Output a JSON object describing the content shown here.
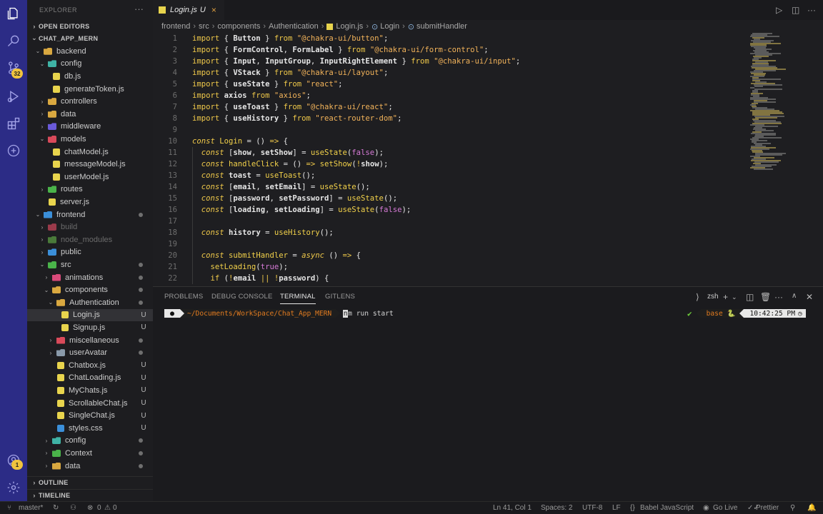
{
  "activity_bar": {
    "items": [
      "explorer-icon",
      "search-icon",
      "source-control-icon",
      "run-debug-icon",
      "extensions-icon",
      "remote-icon"
    ],
    "scm_badge": "32",
    "account_badge": "1",
    "bottom": [
      "account-icon",
      "gear-icon"
    ]
  },
  "sidebar": {
    "title": "EXPLORER",
    "more": "···",
    "open_editors": "OPEN EDITORS",
    "project": "CHAT_APP_MERN",
    "outline": "OUTLINE",
    "timeline": "TIMELINE",
    "tree": [
      {
        "label": "backend",
        "kind": "folder",
        "open": true,
        "indent": 1,
        "color": "#d9a840"
      },
      {
        "label": "config",
        "kind": "folder",
        "open": true,
        "indent": 2,
        "color": "#3fb3a5"
      },
      {
        "label": "db.js",
        "kind": "js",
        "indent": 3
      },
      {
        "label": "generateToken.js",
        "kind": "js",
        "indent": 3
      },
      {
        "label": "controllers",
        "kind": "folder",
        "open": false,
        "indent": 2,
        "color": "#d9a840"
      },
      {
        "label": "data",
        "kind": "folder",
        "open": false,
        "indent": 2,
        "color": "#d9a840"
      },
      {
        "label": "middleware",
        "kind": "folder",
        "open": false,
        "indent": 2,
        "color": "#6a5ad9"
      },
      {
        "label": "models",
        "kind": "folder",
        "open": true,
        "indent": 2,
        "color": "#d94a5a"
      },
      {
        "label": "chatModel.js",
        "kind": "js",
        "indent": 3
      },
      {
        "label": "messageModel.js",
        "kind": "js",
        "indent": 3
      },
      {
        "label": "userModel.js",
        "kind": "js",
        "indent": 3
      },
      {
        "label": "routes",
        "kind": "folder",
        "open": false,
        "indent": 2,
        "color": "#4ab34a"
      },
      {
        "label": "server.js",
        "kind": "js",
        "indent": 2
      },
      {
        "label": "frontend",
        "kind": "folder",
        "open": true,
        "indent": 1,
        "color": "#3b8fd9",
        "dot": true
      },
      {
        "label": "build",
        "kind": "folder",
        "open": false,
        "indent": 2,
        "color": "#9a3a4a",
        "dim": true
      },
      {
        "label": "node_modules",
        "kind": "folder",
        "open": false,
        "indent": 2,
        "color": "#4a7a3a",
        "dim": true
      },
      {
        "label": "public",
        "kind": "folder",
        "open": false,
        "indent": 2,
        "color": "#3b8fd9"
      },
      {
        "label": "src",
        "kind": "folder",
        "open": true,
        "indent": 2,
        "color": "#4ab34a",
        "dot": true
      },
      {
        "label": "animations",
        "kind": "folder",
        "open": false,
        "indent": 3,
        "color": "#d94a7a",
        "dot": true
      },
      {
        "label": "components",
        "kind": "folder",
        "open": true,
        "indent": 3,
        "color": "#d9a840",
        "dot": true
      },
      {
        "label": "Authentication",
        "kind": "folder",
        "open": true,
        "indent": 4,
        "color": "#d9a840",
        "dot": true
      },
      {
        "label": "Login.js",
        "kind": "js",
        "indent": 5,
        "status": "U",
        "selected": true
      },
      {
        "label": "Signup.js",
        "kind": "js",
        "indent": 5,
        "status": "U"
      },
      {
        "label": "miscellaneous",
        "kind": "folder",
        "open": false,
        "indent": 4,
        "color": "#d94a5a",
        "dot": true
      },
      {
        "label": "userAvatar",
        "kind": "folder",
        "open": false,
        "indent": 4,
        "color": "#8a9aaa",
        "dot": true
      },
      {
        "label": "Chatbox.js",
        "kind": "js",
        "indent": 4,
        "status": "U"
      },
      {
        "label": "ChatLoading.js",
        "kind": "js",
        "indent": 4,
        "status": "U"
      },
      {
        "label": "MyChats.js",
        "kind": "js",
        "indent": 4,
        "status": "U"
      },
      {
        "label": "ScrollableChat.js",
        "kind": "js",
        "indent": 4,
        "status": "U"
      },
      {
        "label": "SingleChat.js",
        "kind": "js",
        "indent": 4,
        "status": "U"
      },
      {
        "label": "styles.css",
        "kind": "css",
        "indent": 4,
        "status": "U"
      },
      {
        "label": "config",
        "kind": "folder",
        "open": false,
        "indent": 3,
        "color": "#3fb3a5",
        "dot": true
      },
      {
        "label": "Context",
        "kind": "folder",
        "open": false,
        "indent": 3,
        "color": "#4ab34a",
        "dot": true
      },
      {
        "label": "data",
        "kind": "folder",
        "open": false,
        "indent": 3,
        "color": "#d9a840",
        "dot": true
      }
    ]
  },
  "tab": {
    "name": "Login.js",
    "status": "U",
    "close": "×"
  },
  "editor_actions": [
    "run-icon",
    "split-editor-icon",
    "more-icon"
  ],
  "breadcrumb": [
    "frontend",
    "src",
    "components",
    "Authentication",
    "Login.js",
    "Login",
    "submitHandler"
  ],
  "code": {
    "lines": [
      {
        "n": "1",
        "html": "<span class='kw'>import</span> { <span class='pl'>Button</span> } <span class='kw'>from</span> <span class='str'>\"@chakra-ui/button\"</span>;"
      },
      {
        "n": "2",
        "html": "<span class='kw'>import</span> { <span class='pl'>FormControl</span>, <span class='pl'>FormLabel</span> } <span class='kw'>from</span> <span class='str'>\"@chakra-ui/form-control\"</span>;"
      },
      {
        "n": "3",
        "html": "<span class='kw'>import</span> { <span class='pl'>Input</span>, <span class='pl'>InputGroup</span>, <span class='pl'>InputRightElement</span> } <span class='kw'>from</span> <span class='str'>\"@chakra-ui/input\"</span>;"
      },
      {
        "n": "4",
        "html": "<span class='kw'>import</span> { <span class='pl'>VStack</span> } <span class='kw'>from</span> <span class='str'>\"@chakra-ui/layout\"</span>;"
      },
      {
        "n": "5",
        "html": "<span class='kw'>import</span> { <span class='pl'>useState</span> } <span class='kw'>from</span> <span class='str'>\"react\"</span>;"
      },
      {
        "n": "6",
        "html": "<span class='kw'>import</span> <span class='pl'>axios</span> <span class='kw'>from</span> <span class='str'>\"axios\"</span>;"
      },
      {
        "n": "7",
        "html": "<span class='kw'>import</span> { <span class='pl'>useToast</span> } <span class='kw'>from</span> <span class='str'>\"@chakra-ui/react\"</span>;"
      },
      {
        "n": "8",
        "html": "<span class='kw'>import</span> { <span class='pl'>useHistory</span> } <span class='kw'>from</span> <span class='str'>\"react-router-dom\"</span>;"
      },
      {
        "n": "9",
        "html": ""
      },
      {
        "n": "10",
        "html": "<span class='kw2'>const</span> <span class='fn'>Login</span> = () <span class='kw'>=&gt;</span> {"
      },
      {
        "n": "11",
        "html": "  <span class='kw2'>const</span> [<span class='pl'>show</span>, <span class='pl'>setShow</span>] = <span class='fn'>useState</span>(<span class='bool'>false</span>);"
      },
      {
        "n": "12",
        "html": "  <span class='kw2'>const</span> <span class='fn'>handleClick</span> = () <span class='kw'>=&gt;</span> <span class='fn'>setShow</span>(<span class='kw'>!</span><span class='pl'>show</span>);"
      },
      {
        "n": "13",
        "html": "  <span class='kw2'>const</span> <span class='pl'>toast</span> = <span class='fn'>useToast</span>();"
      },
      {
        "n": "14",
        "html": "  <span class='kw2'>const</span> [<span class='pl'>email</span>, <span class='pl'>setEmail</span>] = <span class='fn'>useState</span>();"
      },
      {
        "n": "15",
        "html": "  <span class='kw2'>const</span> [<span class='pl'>password</span>, <span class='pl'>setPassword</span>] = <span class='fn'>useState</span>();"
      },
      {
        "n": "16",
        "html": "  <span class='kw2'>const</span> [<span class='pl'>loading</span>, <span class='pl'>setLoading</span>] = <span class='fn'>useState</span>(<span class='bool'>false</span>);"
      },
      {
        "n": "17",
        "html": ""
      },
      {
        "n": "18",
        "html": "  <span class='kw2'>const</span> <span class='pl'>history</span> = <span class='fn'>useHistory</span>();"
      },
      {
        "n": "19",
        "html": ""
      },
      {
        "n": "20",
        "html": "  <span class='kw2'>const</span> <span class='fn'>submitHandler</span> = <span class='kw2'>async</span> () <span class='kw'>=&gt;</span> {"
      },
      {
        "n": "21",
        "html": "    <span class='fn'>setLoading</span>(<span class='bool'>true</span>);"
      },
      {
        "n": "22",
        "html": "    <span class='kw'>if</span> (<span class='kw'>!</span><span class='pl'>email</span> <span class='kw'>||</span> <span class='kw'>!</span><span class='pl'>password</span>) {"
      }
    ]
  },
  "panel": {
    "tabs": [
      "PROBLEMS",
      "DEBUG CONSOLE",
      "TERMINAL",
      "GITLENS"
    ],
    "active_tab": "TERMINAL",
    "shell": "zsh"
  },
  "terminal": {
    "path": "~/Documents/WorkSpace/Chat_App_MERN",
    "cursor_char": "n",
    "command": "m run start",
    "env": "base 🐍",
    "time": "10:42:25 PM"
  },
  "statusbar": {
    "branch": "master*",
    "errors": "0",
    "warnings": "0",
    "position": "Ln 41, Col 1",
    "spaces": "Spaces: 2",
    "encoding": "UTF-8",
    "eol": "LF",
    "language": "Babel JavaScript",
    "golive": "Go Live",
    "prettier": "Prettier"
  }
}
